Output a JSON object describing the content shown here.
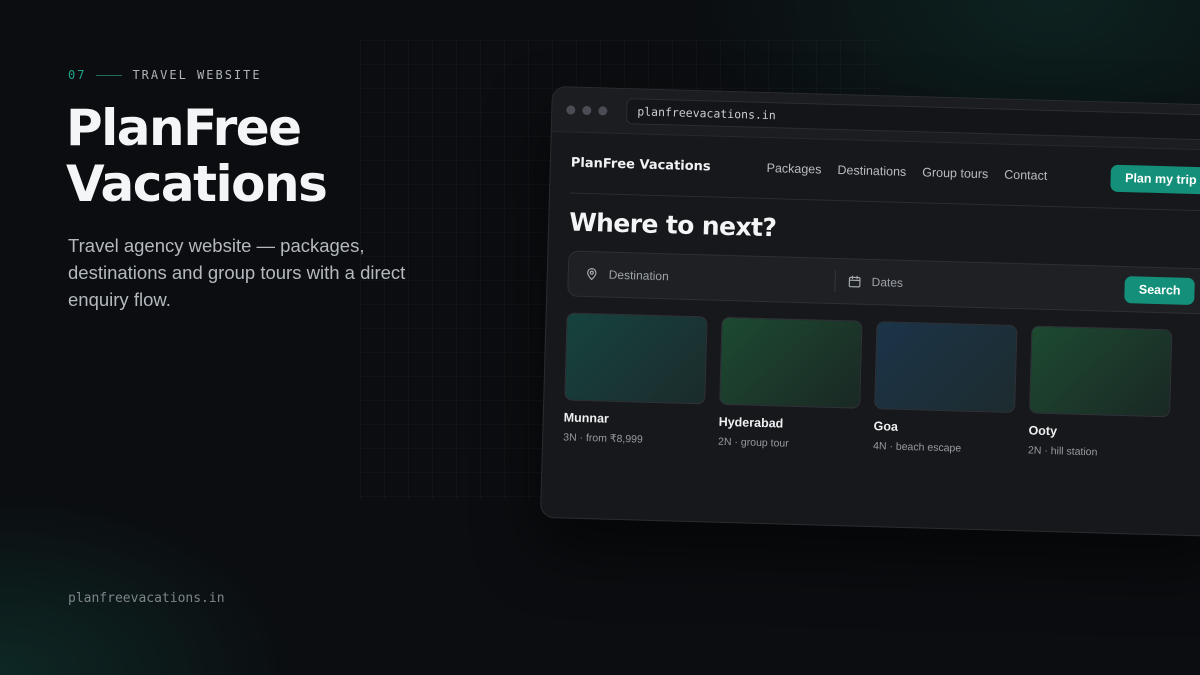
{
  "eyebrow": {
    "number": "07",
    "label": "TRAVEL WEBSITE"
  },
  "headline": {
    "line1": "PlanFree",
    "line2": "Vacations"
  },
  "description": "Travel agency website — packages, destinations and group tours with a direct enquiry flow.",
  "footer_url": "planfreevacations.in",
  "browser": {
    "url": "planfreevacations.in",
    "site": {
      "brand": "PlanFree Vacations",
      "nav": [
        "Packages",
        "Destinations",
        "Group tours",
        "Contact"
      ],
      "cta": "Plan my trip",
      "hero_title": "Where to next?",
      "search": {
        "destination_placeholder": "Destination",
        "dates_placeholder": "Dates",
        "button": "Search"
      },
      "cards": [
        {
          "name": "Munnar",
          "detail": "3N · from ₹8,999"
        },
        {
          "name": "Hyderabad",
          "detail": "2N · group tour"
        },
        {
          "name": "Goa",
          "detail": "4N · beach escape"
        },
        {
          "name": "Ooty",
          "detail": "2N · hill station"
        }
      ]
    }
  },
  "colors": {
    "accent": "#14907a",
    "background": "#0b0d10"
  }
}
